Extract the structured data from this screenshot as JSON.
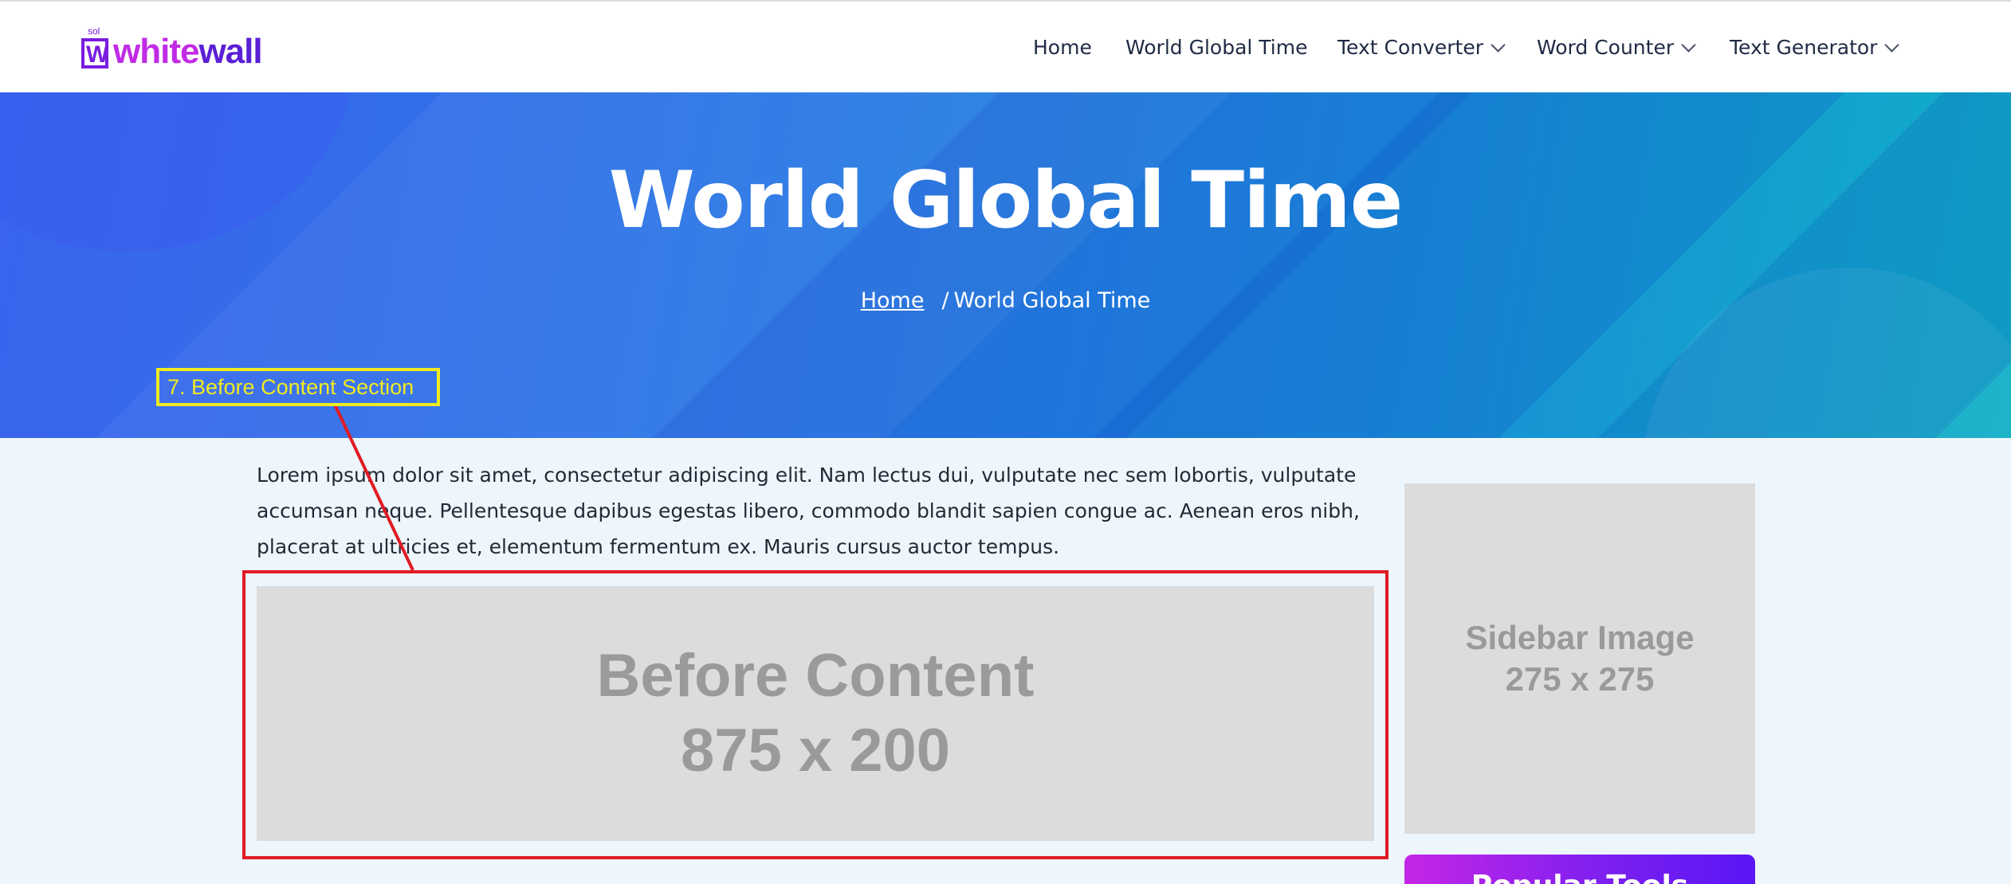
{
  "logo": {
    "small": "sol",
    "mark": "W",
    "part1": "white",
    "part2": "wall"
  },
  "nav": {
    "items": [
      {
        "label": "Home",
        "dropdown": false
      },
      {
        "label": "World Global Time",
        "dropdown": false
      },
      {
        "label": "Text Converter",
        "dropdown": true
      },
      {
        "label": "Word Counter",
        "dropdown": true
      },
      {
        "label": "Text Generator",
        "dropdown": true
      }
    ]
  },
  "hero": {
    "title": "World Global Time",
    "breadcrumb": {
      "home": "Home",
      "separator": "/",
      "current": "World Global Time"
    }
  },
  "annotation": {
    "label": "7. Before Content Section",
    "color": "#f0ea20",
    "box_color": "#e01b24"
  },
  "content": {
    "lorem": "Lorem ipsum dolor sit amet, consectetur adipiscing elit. Nam lectus dui, vulputate nec sem lobortis, vulputate accumsan neque. Pellentesque dapibus egestas libero, commodo blandit sapien congue ac. Aenean eros nibh, placerat at ultricies et, elementum fermentum ex. Mauris cursus auctor tempus.",
    "before_content": {
      "line1": "Before Content",
      "line2": "875 x 200"
    }
  },
  "sidebar": {
    "image": {
      "line1": "Sidebar Image",
      "line2": "275 x 275"
    },
    "popular_tools": "Popular Tools"
  },
  "colors": {
    "brand_pink": "#c22be6",
    "brand_purple": "#5b1fd6",
    "hero_start": "#3a64ee",
    "hero_end": "#0fb0c6"
  }
}
